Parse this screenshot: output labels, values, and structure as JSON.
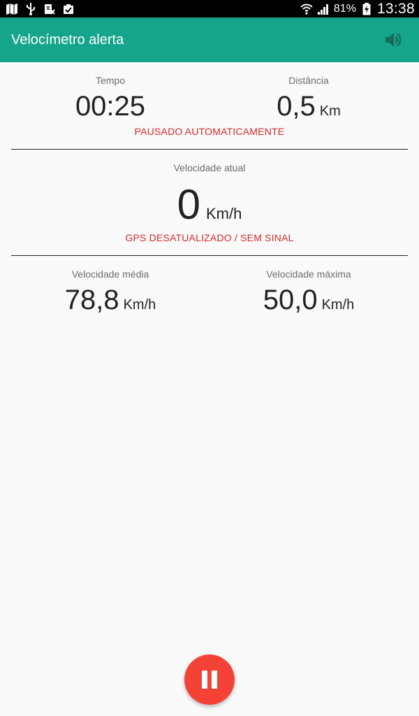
{
  "status_bar": {
    "battery_percent": "81%",
    "time": "13:38",
    "icons": [
      "maps-icon",
      "usb-icon",
      "exchange-icon",
      "clipboard-icon",
      "wifi-icon",
      "signal-icon",
      "battery-icon"
    ]
  },
  "app_bar": {
    "title": "Velocímetro alerta",
    "volume_icon": "volume-icon"
  },
  "time_block": {
    "label": "Tempo",
    "value": "00:25"
  },
  "distance_block": {
    "label": "Distância",
    "value": "0,5",
    "unit": "Km"
  },
  "pause_status": "PAUSADO AUTOMATICAMENTE",
  "current_speed": {
    "label": "Velocidade atual",
    "value": "0",
    "unit": "Km/h"
  },
  "gps_status": "GPS DESATUALIZADO / SEM SINAL",
  "avg_speed": {
    "label": "Velocidade média",
    "value": "78,8",
    "unit": "Km/h"
  },
  "max_speed": {
    "label": "Velocidade máxima",
    "value": "50,0",
    "unit": "Km/h"
  },
  "fab": {
    "icon": "pause-icon"
  },
  "colors": {
    "accent": "#15a58c",
    "alert": "#d62828",
    "fab": "#f44336"
  }
}
